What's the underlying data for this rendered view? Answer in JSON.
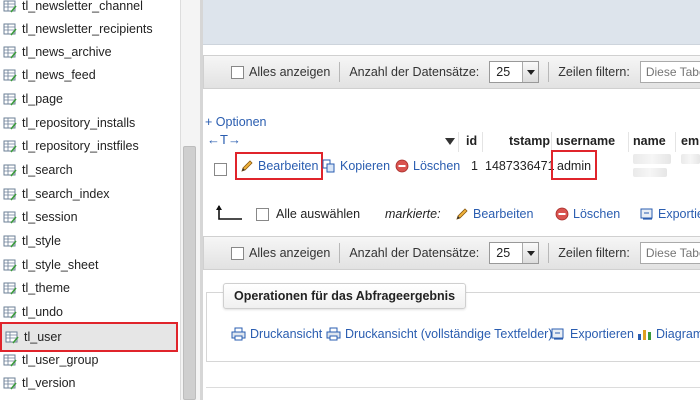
{
  "sidebar": {
    "items": [
      {
        "label": "tl_newsletter_channel"
      },
      {
        "label": "tl_newsletter_recipients"
      },
      {
        "label": "tl_news_archive"
      },
      {
        "label": "tl_news_feed"
      },
      {
        "label": "tl_page"
      },
      {
        "label": "tl_repository_installs"
      },
      {
        "label": "tl_repository_instfiles"
      },
      {
        "label": "tl_search"
      },
      {
        "label": "tl_search_index"
      },
      {
        "label": "tl_session"
      },
      {
        "label": "tl_style"
      },
      {
        "label": "tl_style_sheet"
      },
      {
        "label": "tl_theme"
      },
      {
        "label": "tl_undo"
      },
      {
        "label": "tl_user",
        "active": true
      },
      {
        "label": "tl_user_group"
      },
      {
        "label": "tl_version"
      }
    ]
  },
  "navbar": {
    "show_all_label": "Alles anzeigen",
    "record_count_label": "Anzahl der Datensätze:",
    "record_count_value": "25",
    "row_filter_label": "Zeilen filtern:",
    "row_filter_placeholder": "Diese Tabe"
  },
  "options_link": "+ Optionen",
  "table": {
    "sort_arrows": "←T→",
    "columns": [
      "id",
      "tstamp",
      "username",
      "name",
      "em"
    ],
    "row": {
      "edit_label": "Bearbeiten",
      "copy_label": "Kopieren",
      "delete_label": "Löschen",
      "id": "1",
      "tstamp": "1487336471",
      "username": "admin"
    }
  },
  "bulk": {
    "select_all_label": "Alle auswählen",
    "marked_label": "markierte:",
    "edit_label": "Bearbeiten",
    "delete_label": "Löschen",
    "export_label": "Exportie"
  },
  "query_ops": {
    "legend": "Operationen für das Abfrageergebnis",
    "print_view": "Druckansicht",
    "print_view_full": "Druckansicht (vollständige Textfelder)",
    "export": "Exportieren",
    "chart": "Diagramm"
  },
  "colors": {
    "highlight": "#e0242b",
    "link": "#2a5db0"
  }
}
